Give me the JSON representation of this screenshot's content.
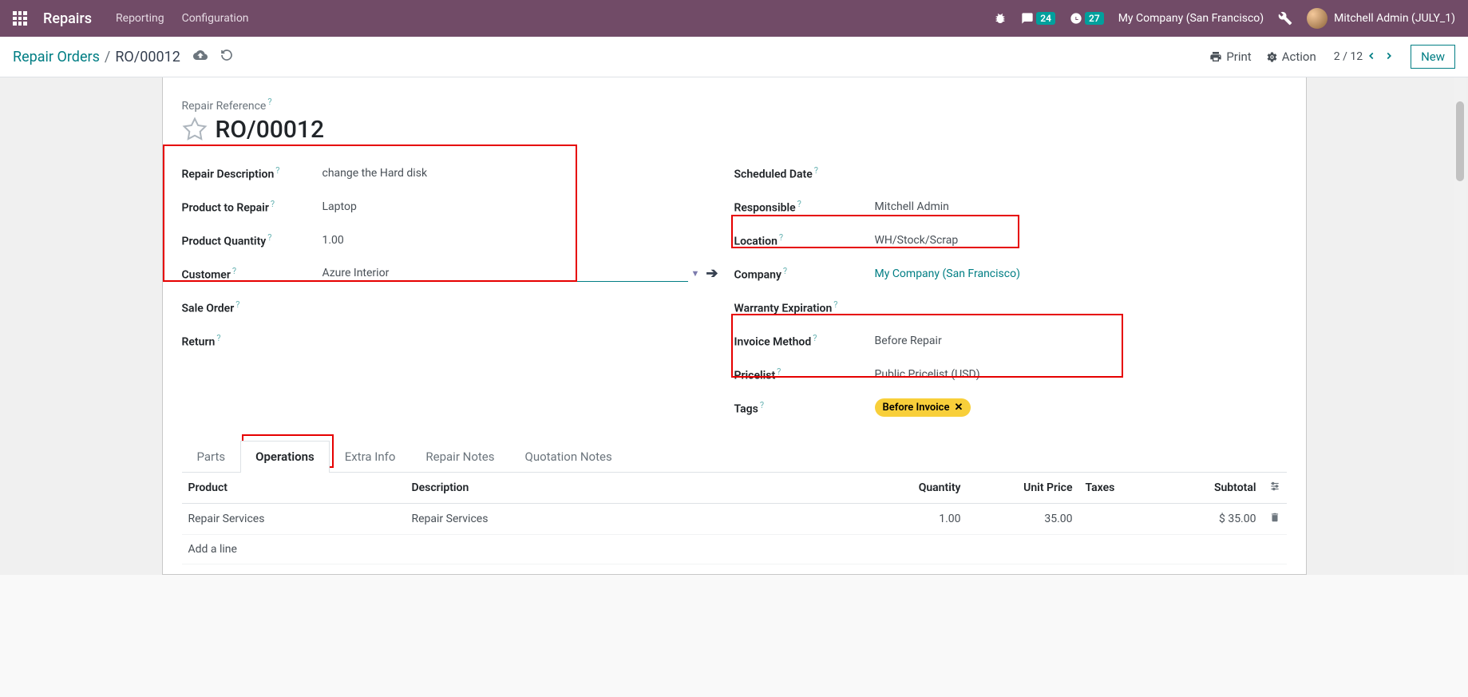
{
  "navbar": {
    "app_title": "Repairs",
    "menu_reporting": "Reporting",
    "menu_configuration": "Configuration",
    "messages_badge": "24",
    "activities_badge": "27",
    "company_name": "My Company (San Francisco)",
    "user_name": "Mitchell Admin (JULY_1)"
  },
  "control": {
    "breadcrumb_root": "Repair Orders",
    "breadcrumb_current": "RO/00012",
    "print_label": "Print",
    "action_label": "Action",
    "pager_text": "2 / 12",
    "new_label": "New"
  },
  "form": {
    "title_label": "Repair Reference",
    "title_value": "RO/00012",
    "left": {
      "repair_description_label": "Repair Description",
      "repair_description_value": "change the Hard disk",
      "product_to_repair_label": "Product to Repair",
      "product_to_repair_value": "Laptop",
      "product_quantity_label": "Product Quantity",
      "product_quantity_value": "1.00",
      "customer_label": "Customer",
      "customer_value": "Azure Interior",
      "sale_order_label": "Sale Order",
      "return_label": "Return"
    },
    "right": {
      "scheduled_date_label": "Scheduled Date",
      "responsible_label": "Responsible",
      "responsible_value": "Mitchell Admin",
      "location_label": "Location",
      "location_value": "WH/Stock/Scrap",
      "company_label": "Company",
      "company_value": "My Company (San Francisco)",
      "warranty_label": "Warranty Expiration",
      "invoice_method_label": "Invoice Method",
      "invoice_method_value": "Before Repair",
      "pricelist_label": "Pricelist",
      "pricelist_value": "Public Pricelist (USD)",
      "tags_label": "Tags",
      "tag_value": "Before Invoice"
    }
  },
  "tabs": {
    "parts": "Parts",
    "operations": "Operations",
    "extra_info": "Extra Info",
    "repair_notes": "Repair Notes",
    "quotation_notes": "Quotation Notes"
  },
  "table": {
    "col_product": "Product",
    "col_description": "Description",
    "col_quantity": "Quantity",
    "col_unit_price": "Unit Price",
    "col_taxes": "Taxes",
    "col_subtotal": "Subtotal",
    "row1": {
      "product": "Repair Services",
      "description": "Repair Services",
      "quantity": "1.00",
      "unit_price": "35.00",
      "subtotal": "$ 35.00"
    },
    "add_line": "Add a line"
  }
}
